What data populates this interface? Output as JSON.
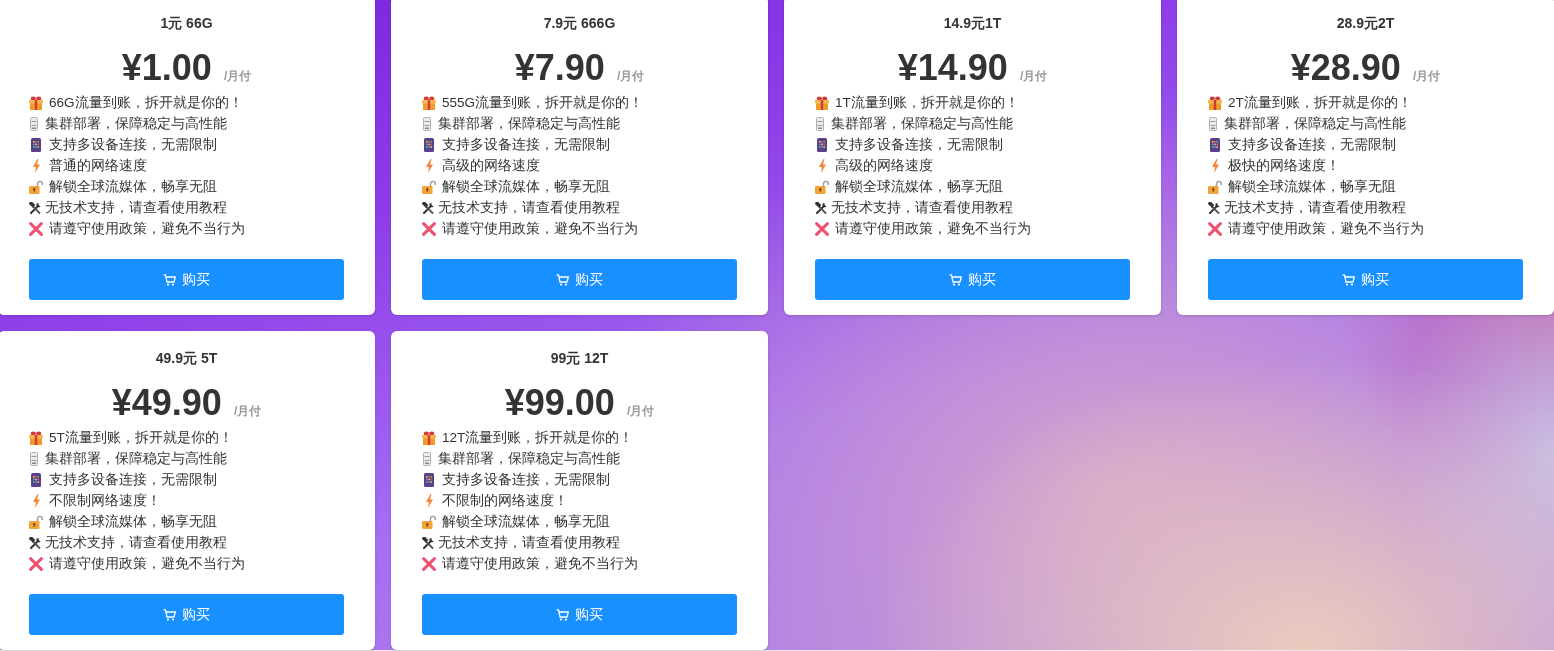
{
  "plans": [
    {
      "title": "1元 66G",
      "price": "¥1.00",
      "period": "/月付",
      "features": [
        {
          "kind": "gift",
          "text": "66G流量到账，拆开就是你的！"
        },
        {
          "kind": "server",
          "text": "集群部署，保障稳定与高性能"
        },
        {
          "kind": "phone",
          "text": "支持多设备连接，无需限制"
        },
        {
          "kind": "bolt",
          "text": "普通的网络速度"
        },
        {
          "kind": "unlock",
          "text": "解锁全球流媒体，畅享无阻"
        },
        {
          "kind": "tools",
          "text": "无技术支持，请查看使用教程"
        },
        {
          "kind": "cross",
          "text": "请遵守使用政策，避免不当行为"
        }
      ],
      "button": "购买"
    },
    {
      "title": "7.9元 666G",
      "price": "¥7.90",
      "period": "/月付",
      "features": [
        {
          "kind": "gift",
          "text": "555G流量到账，拆开就是你的！"
        },
        {
          "kind": "server",
          "text": "集群部署，保障稳定与高性能"
        },
        {
          "kind": "phone",
          "text": "支持多设备连接，无需限制"
        },
        {
          "kind": "bolt",
          "text": "高级的网络速度"
        },
        {
          "kind": "unlock",
          "text": "解锁全球流媒体，畅享无阻"
        },
        {
          "kind": "tools",
          "text": "无技术支持，请查看使用教程"
        },
        {
          "kind": "cross",
          "text": "请遵守使用政策，避免不当行为"
        }
      ],
      "button": "购买"
    },
    {
      "title": "14.9元1T",
      "price": "¥14.90",
      "period": "/月付",
      "features": [
        {
          "kind": "gift",
          "text": "1T流量到账，拆开就是你的！"
        },
        {
          "kind": "server",
          "text": "集群部署，保障稳定与高性能"
        },
        {
          "kind": "phone",
          "text": "支持多设备连接，无需限制"
        },
        {
          "kind": "bolt",
          "text": "高级的网络速度"
        },
        {
          "kind": "unlock",
          "text": "解锁全球流媒体，畅享无阻"
        },
        {
          "kind": "tools",
          "text": "无技术支持，请查看使用教程"
        },
        {
          "kind": "cross",
          "text": "请遵守使用政策，避免不当行为"
        }
      ],
      "button": "购买"
    },
    {
      "title": "28.9元2T",
      "price": "¥28.90",
      "period": "/月付",
      "features": [
        {
          "kind": "gift",
          "text": "2T流量到账，拆开就是你的！"
        },
        {
          "kind": "server",
          "text": "集群部署，保障稳定与高性能"
        },
        {
          "kind": "phone",
          "text": "支持多设备连接，无需限制"
        },
        {
          "kind": "bolt",
          "text": "极快的网络速度！"
        },
        {
          "kind": "unlock",
          "text": "解锁全球流媒体，畅享无阻"
        },
        {
          "kind": "tools",
          "text": "无技术支持，请查看使用教程"
        },
        {
          "kind": "cross",
          "text": "请遵守使用政策，避免不当行为"
        }
      ],
      "button": "购买"
    },
    {
      "title": "49.9元 5T",
      "price": "¥49.90",
      "period": "/月付",
      "features": [
        {
          "kind": "gift",
          "text": "5T流量到账，拆开就是你的！"
        },
        {
          "kind": "server",
          "text": "集群部署，保障稳定与高性能"
        },
        {
          "kind": "phone",
          "text": "支持多设备连接，无需限制"
        },
        {
          "kind": "bolt",
          "text": "不限制网络速度！"
        },
        {
          "kind": "unlock",
          "text": "解锁全球流媒体，畅享无阻"
        },
        {
          "kind": "tools",
          "text": "无技术支持，请查看使用教程"
        },
        {
          "kind": "cross",
          "text": "请遵守使用政策，避免不当行为"
        }
      ],
      "button": "购买"
    },
    {
      "title": "99元 12T",
      "price": "¥99.00",
      "period": "/月付",
      "features": [
        {
          "kind": "gift",
          "text": "12T流量到账，拆开就是你的！"
        },
        {
          "kind": "server",
          "text": "集群部署，保障稳定与高性能"
        },
        {
          "kind": "phone",
          "text": "支持多设备连接，无需限制"
        },
        {
          "kind": "bolt",
          "text": "不限制的网络速度！"
        },
        {
          "kind": "unlock",
          "text": "解锁全球流媒体，畅享无阻"
        },
        {
          "kind": "tools",
          "text": "无技术支持，请查看使用教程"
        },
        {
          "kind": "cross",
          "text": "请遵守使用政策，避免不当行为"
        }
      ],
      "button": "购买"
    }
  ]
}
